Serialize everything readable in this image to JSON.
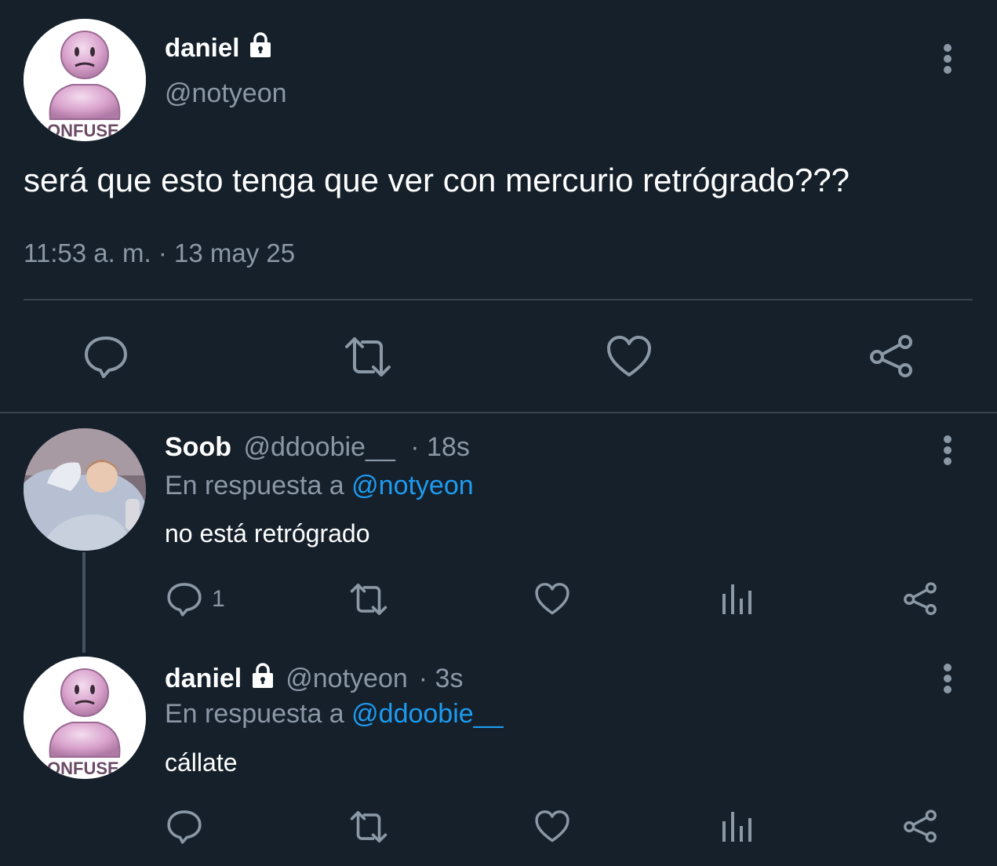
{
  "main_tweet": {
    "display_name": "daniel",
    "handle": "@notyeon",
    "text": "será que esto tenga que ver con mercurio retrógrado???",
    "timestamp": "11:53 a. m. · 13 may 25",
    "avatar_text": "ONFUSE",
    "icons": [
      "lock-icon",
      "more-icon",
      "reply-icon",
      "retweet-icon",
      "like-icon",
      "share-icon"
    ]
  },
  "reply_1": {
    "display_name": "Soob",
    "handle": "@ddoobie__",
    "time": "· 18s",
    "reply_prefix": "En respuesta a",
    "reply_to": "@notyeon",
    "text": "no está retrógrado",
    "reply_count": "1"
  },
  "reply_2": {
    "display_name": "daniel",
    "handle": "@notyeon",
    "time": "· 3s",
    "reply_prefix": "En respuesta a",
    "reply_to": "@ddoobie__",
    "text": "cállate",
    "avatar_text": "ONFUSE"
  },
  "colors": {
    "background": "#15202b",
    "text": "#e7e9ea",
    "muted": "#8b98a5",
    "link": "#1d9bf0",
    "divider": "#38444d"
  }
}
